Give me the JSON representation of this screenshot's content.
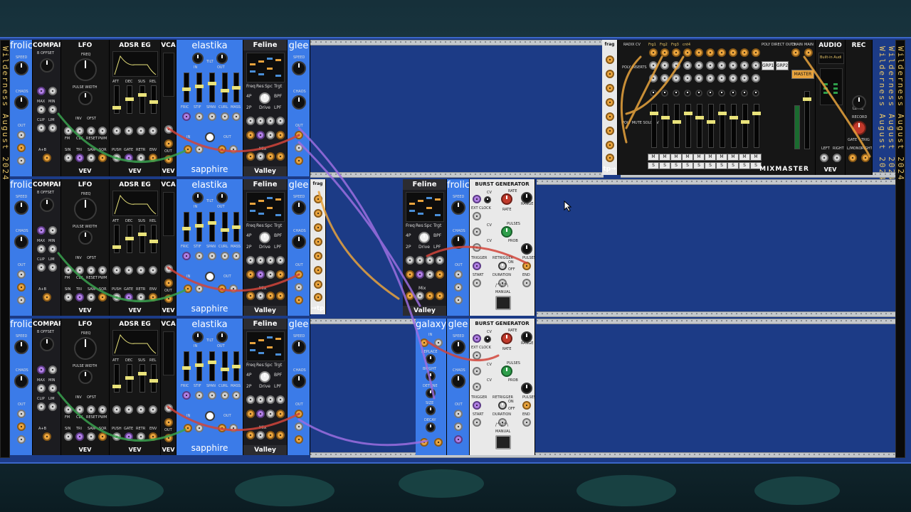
{
  "colors": {
    "rack": "#1c3b86",
    "blue_panel": "#3b7be8",
    "cable_orange": "#e8a33d",
    "cable_purple": "#9b6ee0",
    "cable_green": "#3aa14f",
    "cable_red": "#d2453b"
  },
  "side_rail": {
    "text": "Wilderness August 2024"
  },
  "rows": [
    {
      "frolic": {
        "name": "frolic",
        "speed": "SPEED",
        "chaos": "CHAOS",
        "out": "OUT"
      },
      "compare": {
        "name": "COMPARE",
        "offset": "B OFFSET",
        "clip": "CLIP",
        "lim": "LIM",
        "ab": "A+B",
        "max": "MAX",
        "min": "MIN"
      },
      "lfo": {
        "name": "LFO",
        "freq": "FREQ",
        "pw": "PULSE WIDTH",
        "sin": "SIN",
        "tri": "TRI",
        "saw": "SAW",
        "sqr": "SQR",
        "fm": "FM",
        "clk": "CLK",
        "reset": "RESET",
        "pwm": "PWM",
        "inv": "INV",
        "ofst": "OFST"
      },
      "adsr": {
        "name": "ADSR EG",
        "att": "ATT",
        "dec": "DEC",
        "sus": "SUS",
        "rel": "REL",
        "push": "PUSH",
        "gate": "GATE",
        "rtrg": "RETR",
        "eoc": "EOC",
        "env": "ENV"
      },
      "vca": {
        "name": "VCA",
        "out": "OUT"
      },
      "vev": "VEV",
      "elastika": {
        "name": "elastika",
        "tilt": "TILT",
        "in": "IN",
        "out": "OUT",
        "fric": "FRIC",
        "stif": "STIF",
        "span": "SPAN",
        "curl": "CURL",
        "mass": "MASS",
        "brand": "sapphire"
      },
      "feline": {
        "name": "Feline",
        "freq": "Freq",
        "res": "Res",
        "spc": "Spc",
        "trgt": "Trgt",
        "p4": "4P",
        "p2": "2P",
        "drive": "Drive",
        "bpf": "BPF",
        "lpf": "LPF",
        "mix": "Mix",
        "brand": "Valley"
      },
      "glee": {
        "name": "glee",
        "speed": "SPEED",
        "chaos": "CHAOS",
        "out": "OUT"
      }
    },
    {
      "frolic": {
        "name": "frolic",
        "speed": "SPEED",
        "chaos": "CHAOS",
        "out": "OUT"
      },
      "compare": {
        "name": "COMPARE",
        "offset": "B OFFSET",
        "clip": "CLIP",
        "lim": "LIM",
        "ab": "A+B",
        "max": "MAX",
        "min": "MIN"
      },
      "lfo": {
        "name": "LFO",
        "freq": "FREQ",
        "pw": "PULSE WIDTH",
        "sin": "SIN",
        "tri": "TRI",
        "saw": "SAW",
        "sqr": "SQR",
        "fm": "FM",
        "clk": "CLK",
        "reset": "RESET",
        "pwm": "PWM",
        "inv": "INV",
        "ofst": "OFST"
      },
      "adsr": {
        "name": "ADSR EG",
        "att": "ATT",
        "dec": "DEC",
        "sus": "SUS",
        "rel": "REL",
        "push": "PUSH",
        "gate": "GATE",
        "rtrg": "RETR",
        "eoc": "EOC",
        "env": "ENV"
      },
      "vca": {
        "name": "VCA",
        "out": "OUT"
      },
      "vev": "VEV",
      "elastika": {
        "name": "elastika",
        "tilt": "TILT",
        "in": "IN",
        "out": "OUT",
        "fric": "FRIC",
        "stif": "STIF",
        "span": "SPAN",
        "curl": "CURL",
        "mass": "MASS",
        "brand": "sapphire"
      },
      "feline": {
        "name": "Feline",
        "freq": "Freq",
        "res": "Res",
        "spc": "Spc",
        "trgt": "Trgt",
        "p4": "4P",
        "p2": "2P",
        "drive": "Drive",
        "bpf": "BPF",
        "lpf": "LPF",
        "mix": "Mix",
        "brand": "Valley"
      },
      "glee": {
        "name": "glee",
        "speed": "SPEED",
        "chaos": "CHAOS",
        "out": "OUT"
      }
    },
    {
      "frolic": {
        "name": "frolic",
        "speed": "SPEED",
        "chaos": "CHAOS",
        "out": "OUT"
      },
      "compare": {
        "name": "COMPARE",
        "offset": "B OFFSET",
        "clip": "CLIP",
        "lim": "LIM",
        "ab": "A+B",
        "max": "MAX",
        "min": "MIN"
      },
      "lfo": {
        "name": "LFO",
        "freq": "FREQ",
        "pw": "PULSE WIDTH",
        "sin": "SIN",
        "tri": "TRI",
        "saw": "SAW",
        "sqr": "SQR",
        "fm": "FM",
        "clk": "CLK",
        "reset": "RESET",
        "pwm": "PWM",
        "inv": "INV",
        "ofst": "OFST"
      },
      "adsr": {
        "name": "ADSR EG",
        "att": "ATT",
        "dec": "DEC",
        "sus": "SUS",
        "rel": "REL",
        "push": "PUSH",
        "gate": "GATE",
        "rtrg": "RETR",
        "eoc": "EOC",
        "env": "ENV"
      },
      "vca": {
        "name": "VCA",
        "out": "OUT"
      },
      "vev": "VEV",
      "elastika": {
        "name": "elastika",
        "tilt": "TILT",
        "in": "IN",
        "out": "OUT",
        "fric": "FRIC",
        "stif": "STIF",
        "span": "SPAN",
        "curl": "CURL",
        "mass": "MASS",
        "brand": "sapphire"
      },
      "feline": {
        "name": "Feline",
        "freq": "Freq",
        "res": "Res",
        "spc": "Spc",
        "trgt": "Trgt",
        "p4": "4P",
        "p2": "2P",
        "drive": "Drive",
        "bpf": "BPF",
        "lpf": "LPF",
        "mix": "Mix",
        "brand": "Valley"
      },
      "glee": {
        "name": "glee",
        "speed": "SPEED",
        "chaos": "CHAOS",
        "out": "OUT"
      }
    }
  ],
  "tp_top": {
    "name": "frag",
    "foot": "tp→"
  },
  "tp_mid": {
    "name": "frag",
    "foot": "→tp"
  },
  "mixer": {
    "name": "MIXMASTER",
    "radix": "RADIX CV",
    "poly_inserts": "POLY INSERTS",
    "poly_mute": "POLY MUTE SOLO CV",
    "channels": [
      "Frg1",
      "Frg2",
      "Frg3",
      "cnt4",
      "",
      "",
      "",
      "",
      "",
      ""
    ],
    "direct_outs": "POLY DIRECT OUTS",
    "grp1": "GRP1",
    "grp2": "GRP2",
    "chain": "CHAIN",
    "main": "MAIN",
    "master": "MASTER",
    "mute": "M",
    "solo": "S"
  },
  "audio": {
    "name": "AUDIO",
    "device": "Built-in Audi",
    "level": "LEVEL",
    "left": "LEFT",
    "right": "RIGHT",
    "vev": "VEV"
  },
  "rec": {
    "name": "REC",
    "record": "RECORD",
    "gate": "GATE",
    "trig": "TRIG",
    "left": "L/MONO",
    "right": "RIGHT"
  },
  "feline_mid": {
    "name": "Feline",
    "freq": "Freq",
    "res": "Res",
    "spc": "Spc",
    "trgt": "Trgt",
    "p4": "4P",
    "p2": "2P",
    "drive": "Drive",
    "bpf": "BPF",
    "lpf": "LPF",
    "mix": "Mix",
    "brand": "Valley"
  },
  "frolic_mid": {
    "name": "frolic",
    "speed": "SPEED",
    "chaos": "CHAOS",
    "out": "OUT"
  },
  "galaxy": {
    "name": "galaxy",
    "in": "IN",
    "replace": "REPLACE",
    "bright": "BRIGHT",
    "detune": "DETUNE",
    "size": "SIZE",
    "decay": "DECAY",
    "mix": "MIX",
    "out": "OUT"
  },
  "glee_low": {
    "name": "glee",
    "speed": "SPEED",
    "chaos": "CHAOS",
    "out": "OUT"
  },
  "burst": [
    {
      "name": "BURST GENERATOR",
      "cv": "CV",
      "rate": "RATE",
      "range": "RANGE",
      "ext_clock": "EXT CLOCK",
      "pulses": "PULSES",
      "prob": "PROB",
      "trigger": "TRIGGER",
      "retrigger": "RETRIGGER",
      "on": "ON",
      "off": "OFF",
      "start": "START",
      "duration": "DURATION",
      "end": "END",
      "manual": "MANUAL",
      "logo": "/^\\/^\\"
    },
    {
      "name": "BURST GENERATOR",
      "cv": "CV",
      "rate": "RATE",
      "range": "RANGE",
      "ext_clock": "EXT CLOCK",
      "pulses": "PULSES",
      "prob": "PROB",
      "trigger": "TRIGGER",
      "retrigger": "RETRIGGER",
      "on": "ON",
      "off": "OFF",
      "start": "START",
      "duration": "DURATION",
      "end": "END",
      "manual": "MANUAL",
      "logo": "/^\\/^\\"
    }
  ]
}
